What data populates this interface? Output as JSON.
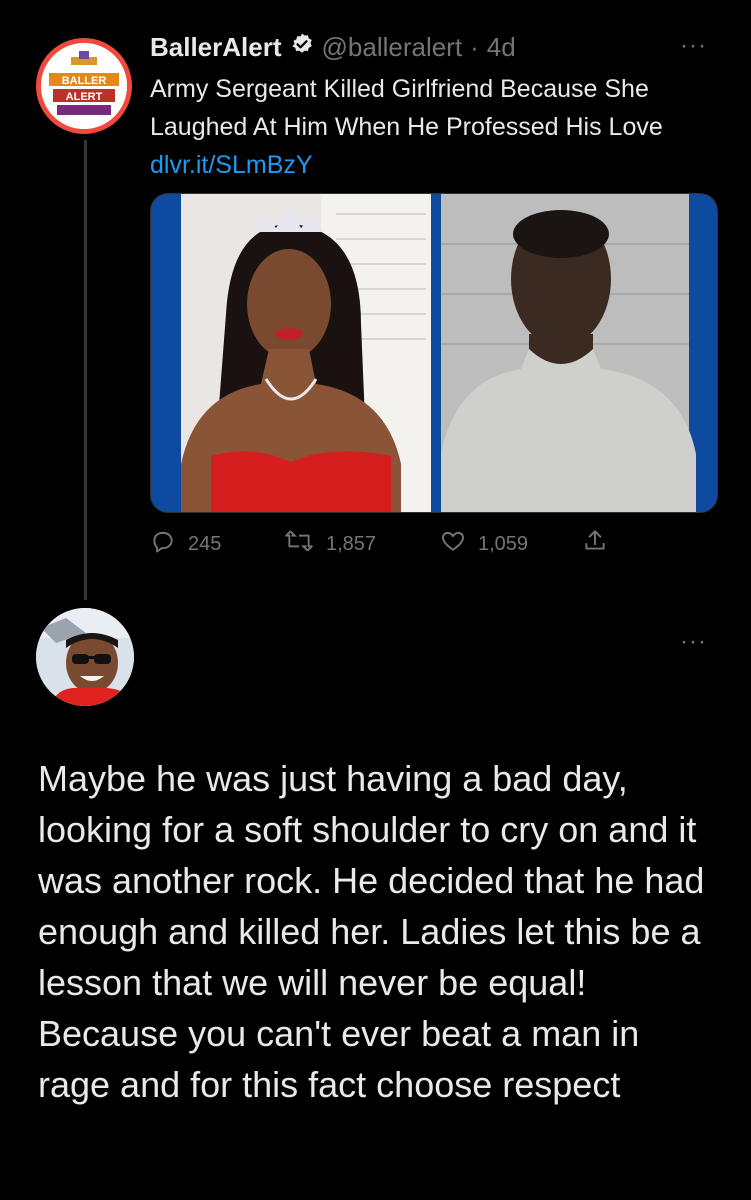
{
  "tweet": {
    "display_name": "BallerAlert",
    "verified_icon": "verified-badge-icon",
    "handle": "@balleralert",
    "separator": "·",
    "time": "4d",
    "more": "···",
    "text": "Army Sergeant Killed Girlfriend Because She Laughed At Him When He Professed His Love ",
    "link": "dlvr.it/SLmBzY",
    "logo_text": "BALLER ALERT",
    "stats": {
      "replies": "245",
      "retweets": "1,857",
      "likes": "1,059"
    }
  },
  "reply": {
    "more": "···",
    "text": "Maybe he was just having a bad day, looking for a soft shoulder to cry on and it was another rock. He decided that he had enough and killed her. Ladies let this be a lesson that we will never be equal! Because you can't ever beat a man in rage and for this fact choose respect"
  },
  "colors": {
    "background": "#000000",
    "text": "#e7e9ea",
    "muted": "#71767b",
    "link": "#1d9bf0",
    "logo_ring": "#ef4a3c"
  }
}
